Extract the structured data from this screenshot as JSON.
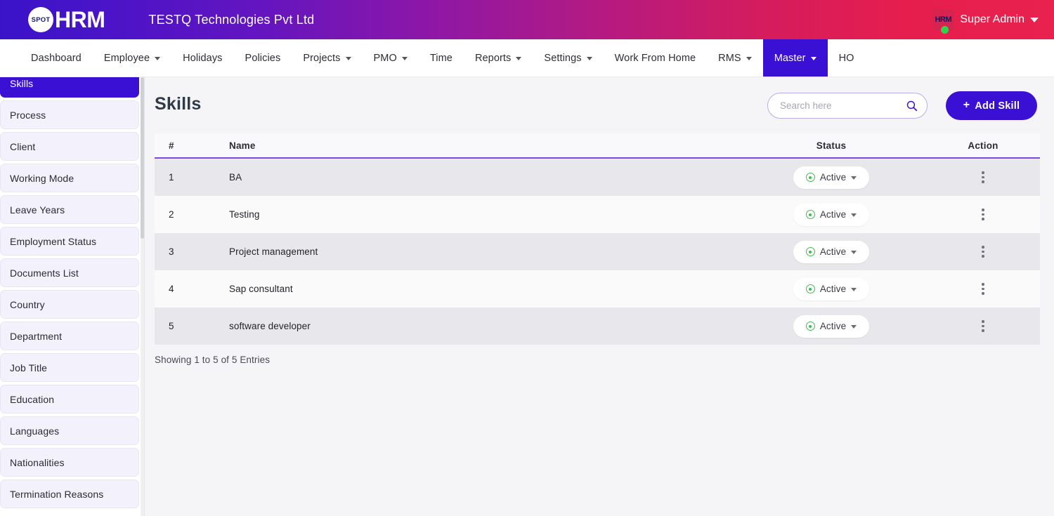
{
  "header": {
    "logo_badge": "SPOT",
    "logo_text": "HRM",
    "company": "TESTQ Technologies Pvt Ltd",
    "avatar_label": "HRM",
    "user_name": "Super Admin",
    "colors": {
      "gradient_start": "#3a13c8",
      "gradient_mid": "#8b17a8",
      "gradient_end": "#e8214e"
    }
  },
  "nav": {
    "items": [
      {
        "label": "Dashboard",
        "has_caret": false,
        "active": false
      },
      {
        "label": "Employee",
        "has_caret": true,
        "active": false
      },
      {
        "label": "Holidays",
        "has_caret": false,
        "active": false
      },
      {
        "label": "Policies",
        "has_caret": false,
        "active": false
      },
      {
        "label": "Projects",
        "has_caret": true,
        "active": false
      },
      {
        "label": "PMO",
        "has_caret": true,
        "active": false
      },
      {
        "label": "Time",
        "has_caret": false,
        "active": false
      },
      {
        "label": "Reports",
        "has_caret": true,
        "active": false
      },
      {
        "label": "Settings",
        "has_caret": true,
        "active": false
      },
      {
        "label": "Work From Home",
        "has_caret": false,
        "active": false
      },
      {
        "label": "RMS",
        "has_caret": true,
        "active": false
      },
      {
        "label": "Master",
        "has_caret": true,
        "active": true
      },
      {
        "label": "HO",
        "has_caret": false,
        "active": false
      }
    ]
  },
  "sidebar": {
    "accent_color": "#3a10d4",
    "items": [
      {
        "label": "Skills",
        "active": true
      },
      {
        "label": "Process",
        "active": false
      },
      {
        "label": "Client",
        "active": false
      },
      {
        "label": "Working Mode",
        "active": false
      },
      {
        "label": "Leave Years",
        "active": false
      },
      {
        "label": "Employment Status",
        "active": false
      },
      {
        "label": "Documents List",
        "active": false
      },
      {
        "label": "Country",
        "active": false
      },
      {
        "label": "Department",
        "active": false
      },
      {
        "label": "Job Title",
        "active": false
      },
      {
        "label": "Education",
        "active": false
      },
      {
        "label": "Languages",
        "active": false
      },
      {
        "label": "Nationalities",
        "active": false
      },
      {
        "label": "Termination Reasons",
        "active": false
      }
    ]
  },
  "main": {
    "page_title": "Skills",
    "search": {
      "placeholder": "Search here",
      "value": ""
    },
    "add_button": {
      "label": "Add Skill",
      "plus": "+"
    },
    "table": {
      "headers": {
        "num": "#",
        "name": "Name",
        "status": "Status",
        "action": "Action"
      },
      "rows": [
        {
          "num": "1",
          "name": "BA",
          "status": "Active"
        },
        {
          "num": "2",
          "name": "Testing",
          "status": "Active"
        },
        {
          "num": "3",
          "name": "Project management",
          "status": "Active"
        },
        {
          "num": "4",
          "name": "Sap consultant",
          "status": "Active"
        },
        {
          "num": "5",
          "name": "software developer",
          "status": "Active"
        }
      ]
    },
    "entries_text": "Showing 1 to 5 of 5 Entries"
  }
}
